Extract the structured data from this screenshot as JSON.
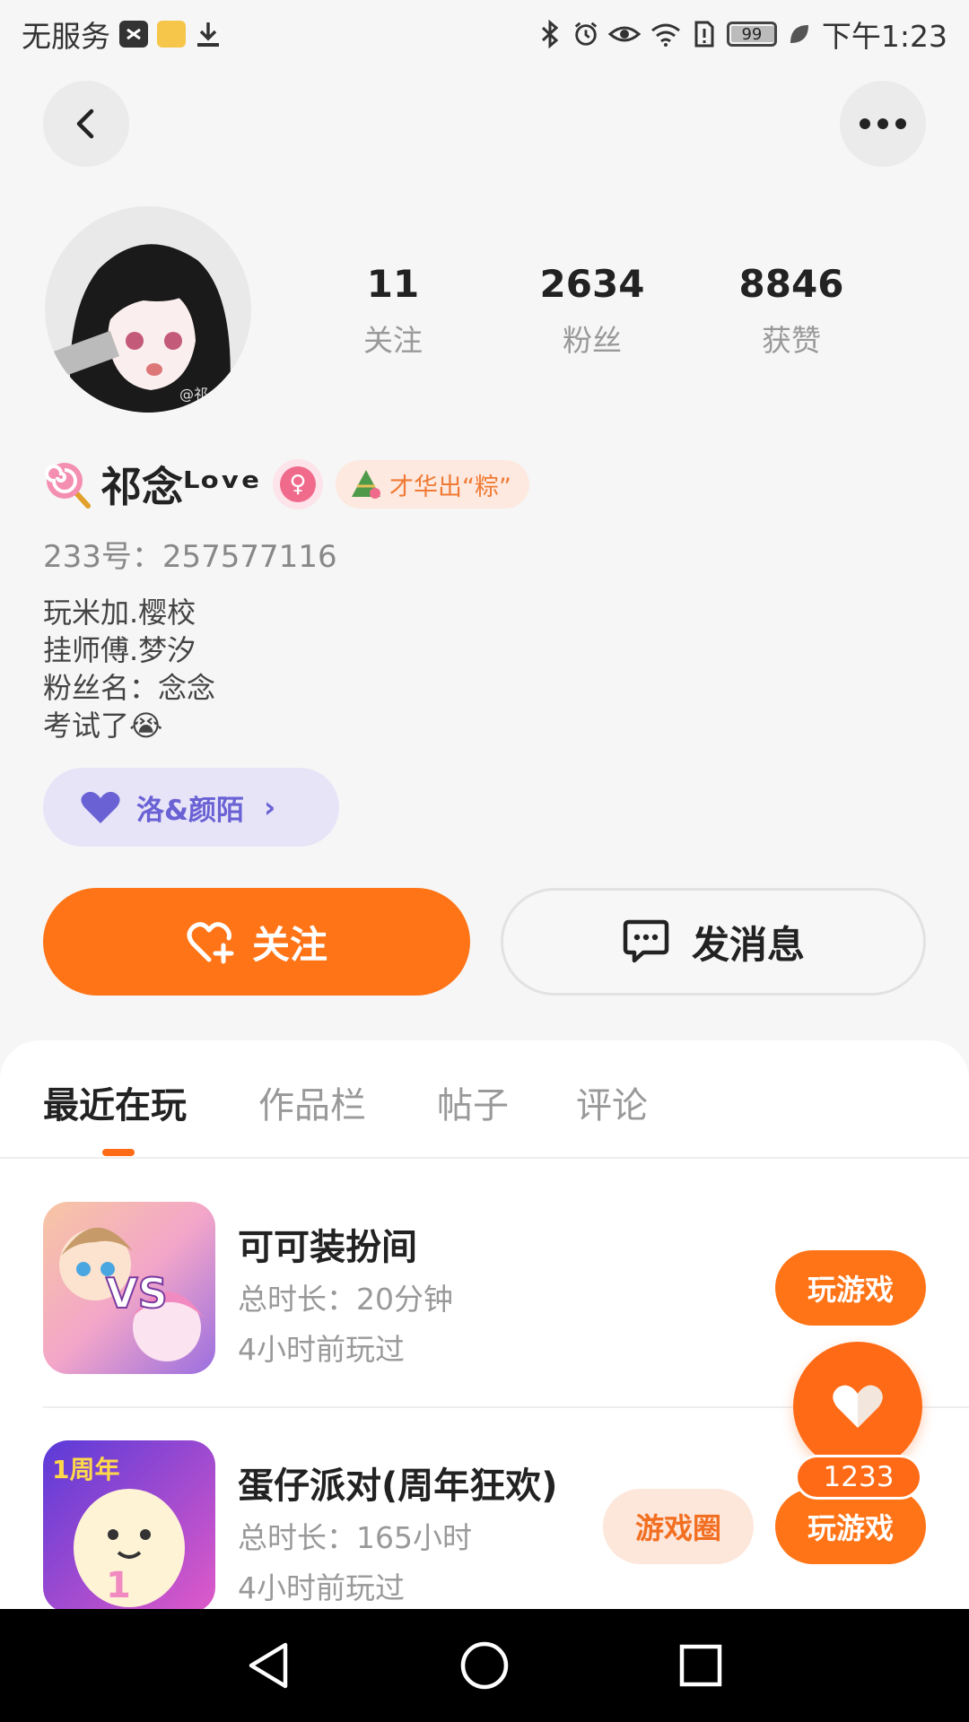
{
  "status_bar": {
    "carrier": "无服务",
    "battery_level": "99",
    "time": "下午1:23",
    "icons": [
      "tiktok-icon",
      "notes-app-icon",
      "download-icon",
      "bluetooth-icon",
      "alarm-icon",
      "eye-care-icon",
      "wifi-icon",
      "sim-alert-icon",
      "battery-icon",
      "leaf-icon"
    ]
  },
  "header": {
    "back_icon": "chevron-left-icon",
    "more_icon": "more-dots-icon"
  },
  "profile": {
    "stats": [
      {
        "value": "11",
        "label": "关注"
      },
      {
        "value": "2634",
        "label": "粉丝"
      },
      {
        "value": "8846",
        "label": "获赞"
      }
    ],
    "name": "祁念ᴸᵒᵛᵉ",
    "gender_symbol": "♀",
    "honor_badge": "才华出“粽”",
    "account_id": "233号：257577116",
    "bio": [
      "玩米加.樱校",
      "挂师傅.梦汐",
      "粉丝名：念念",
      "考试了😭"
    ],
    "fan_group": "洛&颜陌",
    "follow_label": "关注",
    "message_label": "发消息"
  },
  "tabs": [
    {
      "label": "最近在玩",
      "active": true
    },
    {
      "label": "作品栏",
      "active": false
    },
    {
      "label": "帖子",
      "active": false
    },
    {
      "label": "评论",
      "active": false
    }
  ],
  "games": [
    {
      "title": "可可装扮间",
      "duration": "总时长：20分钟",
      "last_played": "4小时前玩过",
      "play_label": "玩游戏"
    },
    {
      "title": "蛋仔派对(周年狂欢)",
      "duration": "总时长：165小时",
      "last_played": "4小时前玩过",
      "play_label": "玩游戏",
      "circle_label": "游戏圈",
      "icon_badge": "1周年"
    }
  ],
  "floating_like": {
    "count": "1233"
  },
  "colors": {
    "accent": "#ff7417",
    "fan_pill": "#e7e4f8",
    "fan_text": "#6a62d4",
    "gender": "#f06a8c"
  }
}
